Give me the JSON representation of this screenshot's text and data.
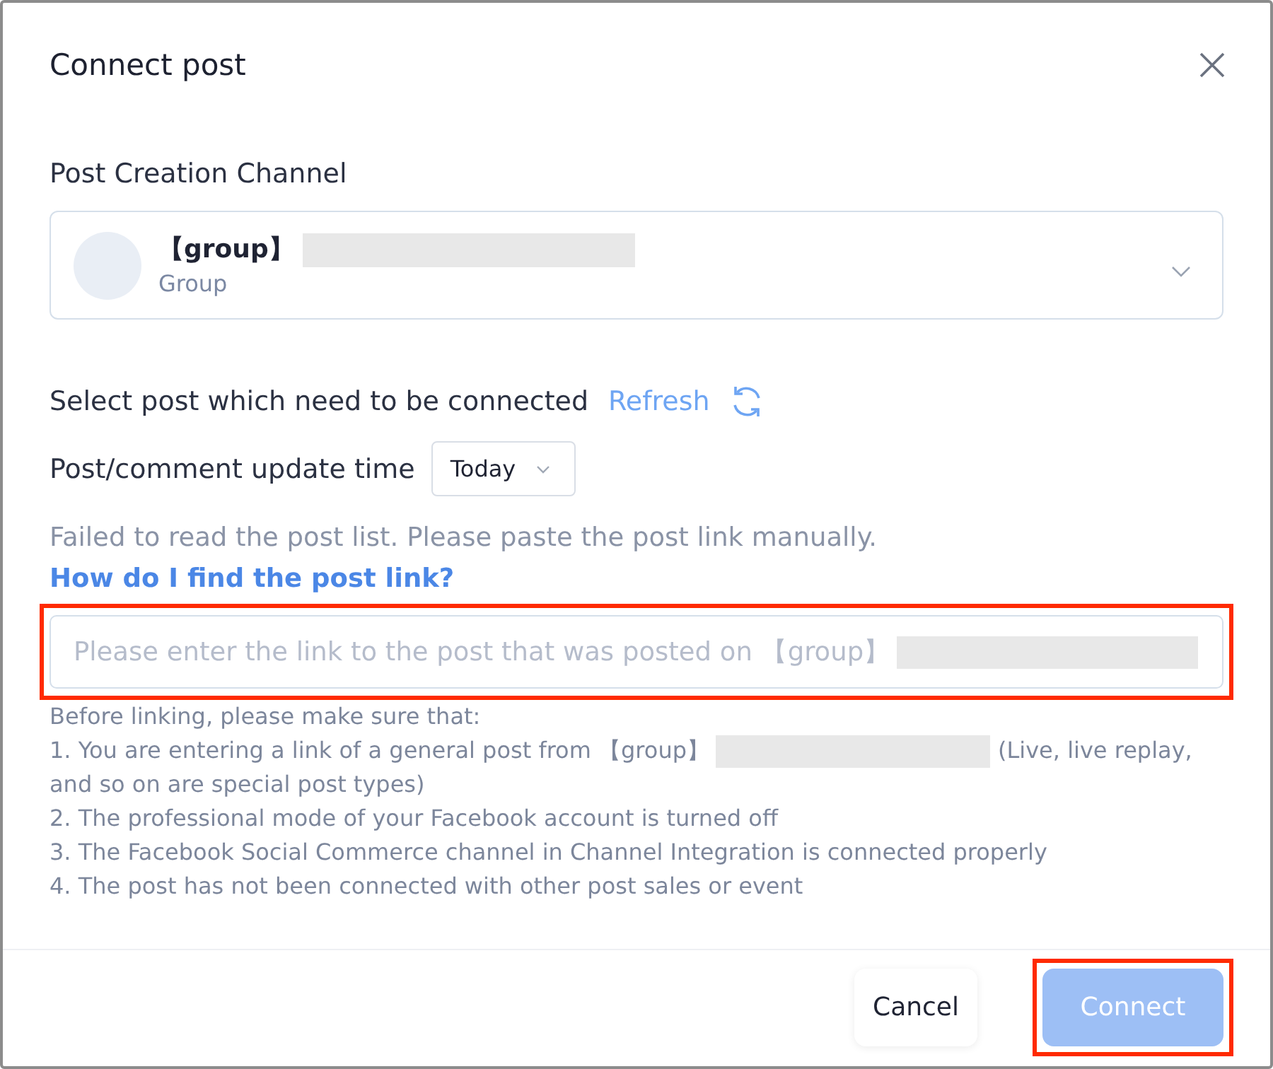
{
  "dialog": {
    "title": "Connect post"
  },
  "channel": {
    "label": "Post Creation Channel",
    "name": "【group】",
    "redacted": true,
    "type": "Group"
  },
  "post_select": {
    "label": "Select post which need to be connected",
    "refresh": "Refresh"
  },
  "update_time": {
    "label": "Post/comment update time",
    "value": "Today"
  },
  "error": {
    "text": "Failed to read the post list. Please paste the post link manually.",
    "link": "How do I find the post link?"
  },
  "link_input": {
    "placeholder": "Please enter the link to the post that was posted on 【group】",
    "redacted": true,
    "highlighted": true
  },
  "notes": {
    "heading": "Before linking, please make sure that:",
    "items": [
      {
        "parts": [
          {
            "kind": "text",
            "text": "1. You are entering a link of a general post from 【group】"
          },
          {
            "kind": "redacted"
          },
          {
            "kind": "text",
            "text": "(Live, live replay, and so on are special post types)"
          }
        ]
      },
      {
        "parts": [
          {
            "kind": "text",
            "text": "2. The professional mode of your Facebook account is turned off"
          }
        ]
      },
      {
        "parts": [
          {
            "kind": "text",
            "text": "3. The Facebook Social Commerce channel in Channel Integration is connected properly"
          }
        ]
      },
      {
        "parts": [
          {
            "kind": "text",
            "text": "4. The post has not been connected with other post sales or event"
          }
        ]
      }
    ]
  },
  "buttons": [
    {
      "label": "Cancel",
      "kind": "secondary",
      "disabled": false,
      "highlighted": false
    },
    {
      "label": "Connect",
      "kind": "primary",
      "disabled": true,
      "highlighted": true
    }
  ]
}
